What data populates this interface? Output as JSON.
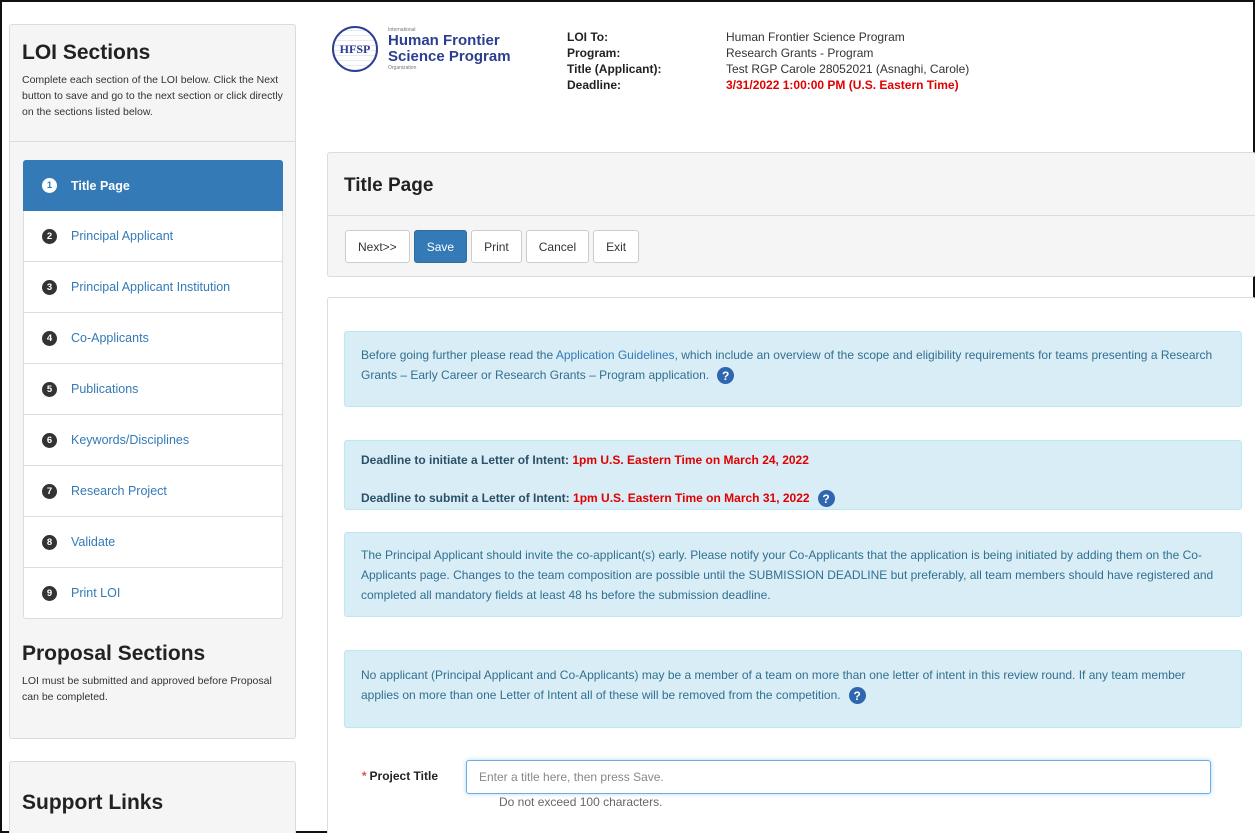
{
  "sidebar": {
    "loi": {
      "title": "LOI Sections",
      "description": "Complete each section of the LOI below. Click the Next button to save and go to the next section or click directly on the sections listed below."
    },
    "items": [
      {
        "num": "1",
        "label": "Title Page"
      },
      {
        "num": "2",
        "label": "Principal Applicant"
      },
      {
        "num": "3",
        "label": "Principal Applicant Institution"
      },
      {
        "num": "4",
        "label": "Co-Applicants"
      },
      {
        "num": "5",
        "label": "Publications"
      },
      {
        "num": "6",
        "label": "Keywords/Disciplines"
      },
      {
        "num": "7",
        "label": "Research Project"
      },
      {
        "num": "8",
        "label": "Validate"
      },
      {
        "num": "9",
        "label": "Print LOI"
      }
    ],
    "proposal": {
      "title": "Proposal Sections",
      "description": "LOI must be submitted and approved before Proposal can be completed."
    },
    "support": {
      "title": "Support Links"
    }
  },
  "logo": {
    "small_top": "International",
    "line1": "Human Frontier",
    "line2": "Science Program",
    "small_bottom": "Organization",
    "mark": "HFSP"
  },
  "header": {
    "loi_to_label": "LOI To:",
    "loi_to_value": "Human Frontier Science Program",
    "program_label": "Program:",
    "program_value": "Research Grants - Program",
    "title_label": "Title (Applicant):",
    "title_value": "Test RGP Carole 28052021 (Asnaghi, Carole)",
    "deadline_label": "Deadline:",
    "deadline_value": "3/31/2022 1:00:00 PM (U.S. Eastern Time)"
  },
  "page": {
    "title": "Title Page",
    "buttons": {
      "next": "Next>>",
      "save": "Save",
      "print": "Print",
      "cancel": "Cancel",
      "exit": "Exit"
    }
  },
  "notices": {
    "guidelines_pre": "Before going further please read the ",
    "guidelines_link": "Application Guidelines",
    "guidelines_post": ", which include an overview of the scope and eligibility requirements for teams presenting a Research Grants – Early Career or Research Grants – Program application.",
    "initiate_label": "Deadline to initiate a Letter of Intent: ",
    "initiate_value": "1pm U.S. Eastern Time on March 24, 2022",
    "submit_label": "Deadline to submit a Letter of Intent: ",
    "submit_value": "1pm U.S. Eastern Time on March 31, 2022",
    "invite_text": "The Principal Applicant should invite the co-applicant(s) early. Please notify your Co-Applicants that the application is being initiated by adding them on the Co-Applicants page. Changes to the team composition are possible until the SUBMISSION DEADLINE but preferably, all team members should have registered and completed all mandatory fields at least 48 hs before the submission deadline.",
    "membership_text": "No applicant (Principal Applicant and Co-Applicants) may be a member of a team on more than one letter of intent in this review round. If any team member applies on more than one Letter of Intent all of these will be removed from the competition."
  },
  "form": {
    "required_mark": "*",
    "project_title_label": "Project Title",
    "project_title_placeholder": "Enter a title here, then press Save.",
    "project_title_value": "",
    "help": "Do not exceed 100 characters."
  },
  "colors": {
    "primary": "#337ab7",
    "alert_bg": "#d9edf7",
    "deadline_red": "#e00000"
  }
}
